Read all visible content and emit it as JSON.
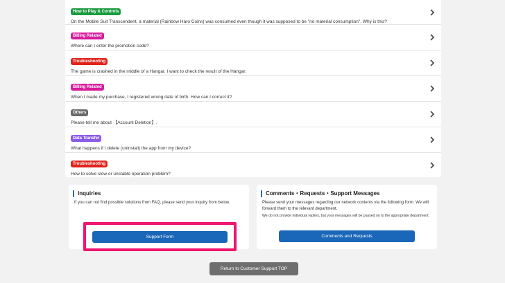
{
  "faq": {
    "items": [
      {
        "tag": "How to Play & Controls",
        "tag_color": "#1a9a3e",
        "question": "On the Mobile Suit Transcendent, a material (Rainbow Haro Coins) was consumed even though it was supposed to be \"no material consumption\". Why is this?"
      },
      {
        "tag": "Billing Related",
        "tag_color": "#d81b9b",
        "question": "Where can I enter the promotion code?"
      },
      {
        "tag": "Troubleshooting",
        "tag_color": "#e0241b",
        "question": "The game is crashed in the middle of a Hangar. I want to check the result of the Hangar."
      },
      {
        "tag": "Billing Related",
        "tag_color": "#d81b9b",
        "question": "When I made my purchase, I registered wrong date of birth. How can I correct it?"
      },
      {
        "tag": "Others",
        "tag_color": "#6b6b6b",
        "question": "Please tell me about 【Account Deletion】."
      },
      {
        "tag": "Data Transfer",
        "tag_color": "#8a5be8",
        "question": "What happens if I delete (uninstall) the app from my device?"
      },
      {
        "tag": "Troubleshooting",
        "tag_color": "#e0241b",
        "question": "How to solve slow or unstable operation problem?"
      }
    ]
  },
  "inquiries": {
    "title": "Inquiries",
    "description": "If you can not find possible solutions from FAQ, please send your inquiry from below.",
    "button_label": "Support Form"
  },
  "comments": {
    "title": "Comments・Requests・Support Messages",
    "description": "Please send your messages regarding our network contents via the following form. We will forward them to the relevant department.",
    "note": "We do not provide individual replies, but your messages will be passed on to the appropriate department.",
    "button_label": "Comments and Requests"
  },
  "footer": {
    "back_label": "Return to Customer Support TOP"
  },
  "colors": {
    "accent_blue": "#1a66b8",
    "highlight": "#f0156e"
  }
}
